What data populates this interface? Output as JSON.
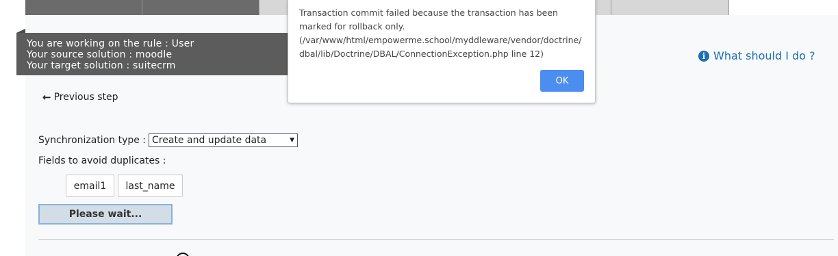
{
  "rule_info": {
    "rule_line": "You are working on the rule : User",
    "source_line": "Your source solution : moodle",
    "target_line": "Your target solution : suitecrm"
  },
  "help": {
    "label": "What should I do ?",
    "icon": "info-circle-icon"
  },
  "navigation": {
    "previous_step_label": "Previous step",
    "icon": "arrow-left-icon"
  },
  "sync": {
    "label": "Synchronization type :",
    "selected": "Create and update data"
  },
  "duplicates": {
    "label": "Fields to avoid duplicates :",
    "fields": [
      "email1",
      "last_name"
    ]
  },
  "action_button": {
    "label": "Please wait..."
  },
  "dialog": {
    "message": "Transaction commit failed because the transaction has been marked for rollback only. (/var/www/html/empowerme.school/myddleware/vendor/doctrine/dbal/lib/Doctrine/DBAL/ConnectionException.php line 12)",
    "ok_label": "OK"
  },
  "colors": {
    "accent": "#4c8df0",
    "link": "#1a6fb5",
    "rule_box": "#5c5c5c"
  }
}
